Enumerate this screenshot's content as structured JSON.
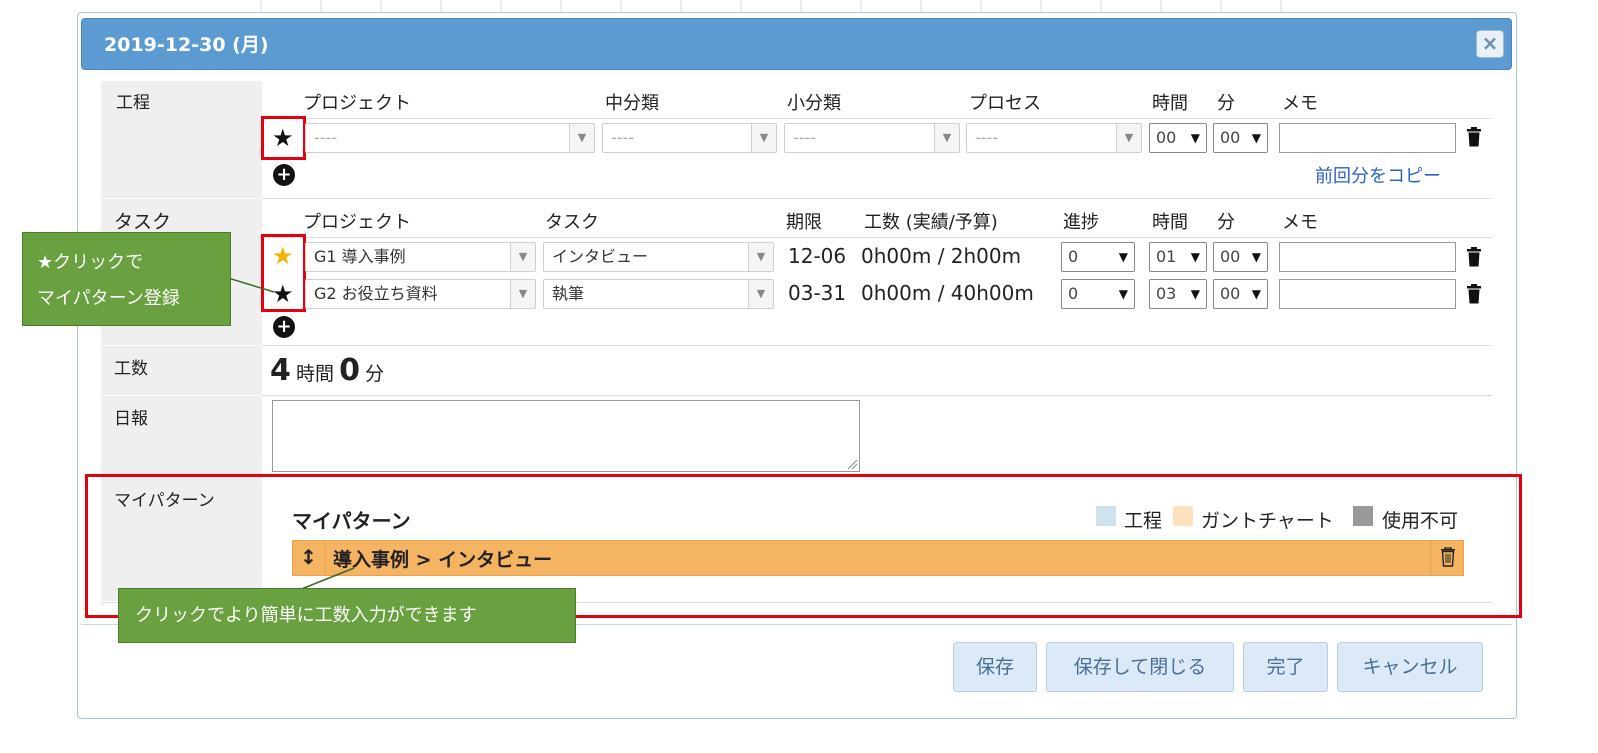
{
  "dialog": {
    "title": "2019-12-30 (月)",
    "close_label": "×"
  },
  "process_section": {
    "label": "工程",
    "headers": {
      "project": "プロジェクト",
      "mid_category": "中分類",
      "sub_category": "小分類",
      "process": "プロセス",
      "hours": "時間",
      "minutes": "分",
      "memo": "メモ"
    },
    "row": {
      "star_icon": "★",
      "project": "----",
      "mid_category": "----",
      "sub_category": "----",
      "process": "----",
      "hours": "00",
      "minutes": "00",
      "memo": ""
    },
    "copy_previous_link": "前回分をコピー"
  },
  "task_section": {
    "label": "タスク",
    "headers": {
      "project": "プロジェクト",
      "task": "タスク",
      "deadline": "期限",
      "effort": "工数 (実績/予算)",
      "progress": "進捗",
      "hours": "時間",
      "minutes": "分",
      "memo": "メモ"
    },
    "rows": [
      {
        "star_icon": "★",
        "starred": true,
        "project": "G1 導入事例",
        "task": "インタビュー",
        "deadline": "12-06",
        "effort": "0h00m / 2h00m",
        "progress": "0",
        "hours": "01",
        "minutes": "00",
        "memo": ""
      },
      {
        "star_icon": "★",
        "starred": false,
        "project": "G2 お役立ち資料",
        "task": "執筆",
        "deadline": "03-31",
        "effort": "0h00m / 40h00m",
        "progress": "0",
        "hours": "03",
        "minutes": "00",
        "memo": ""
      }
    ]
  },
  "effort_section": {
    "label": "工数",
    "hours": "4",
    "hours_unit": "時間",
    "minutes": "0",
    "minutes_unit": "分"
  },
  "daily_report_section": {
    "label": "日報",
    "value": ""
  },
  "my_pattern_section": {
    "label": "マイパターン",
    "title": "マイパターン",
    "legend": [
      {
        "label": "工程",
        "color": "#cfe2ee"
      },
      {
        "label": "ガントチャート",
        "color": "#fde0bd"
      },
      {
        "label": "使用不可",
        "color": "#999999"
      }
    ],
    "patterns": [
      {
        "label": "導入事例 > インタビュー",
        "color": "#f5b461"
      }
    ]
  },
  "callouts": {
    "star_callout_line1": "★クリックで",
    "star_callout_line2": "マイパターン登録",
    "pattern_callout": "クリックでより簡単に工数入力ができます"
  },
  "buttons": {
    "save": "保存",
    "save_close": "保存して閉じる",
    "complete": "完了",
    "cancel": "キャンセル"
  },
  "colors": {
    "title_bar": "#5b9bd1",
    "highlight_red": "#e3000f",
    "callout_green": "#6aa140",
    "star_gold": "#f4b400",
    "link_blue": "#2962c8"
  }
}
